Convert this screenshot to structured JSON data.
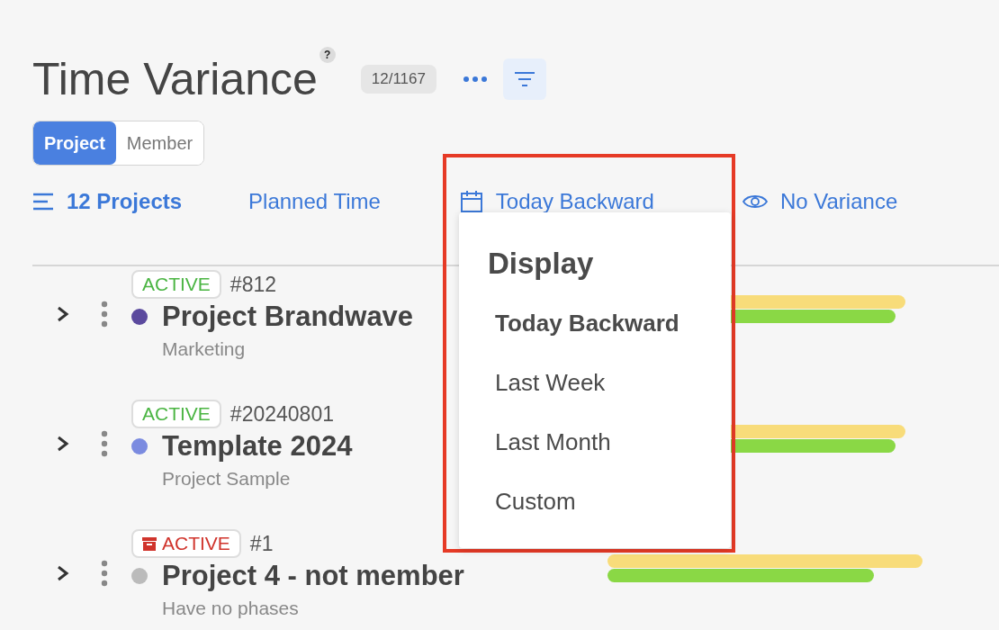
{
  "header": {
    "title": "Time Variance",
    "help": "?",
    "count": "12/1167"
  },
  "view_toggle": [
    {
      "label": "Project",
      "selected": true
    },
    {
      "label": "Member",
      "selected": false
    }
  ],
  "toolbar": [
    {
      "kind": "list",
      "label": "12 Projects"
    },
    {
      "kind": "plain",
      "label": "Planned Time"
    },
    {
      "kind": "calendar",
      "label": "Today Backward"
    },
    {
      "kind": "eye",
      "label": "No Variance"
    }
  ],
  "rows": [
    {
      "status": "ACTIVE",
      "archived": false,
      "number": "#812",
      "name": "Project Brandwave",
      "color": "#5b4a9e",
      "subtitle": "Marketing",
      "bars": [
        {
          "kind": "planned",
          "level": 0.86
        },
        {
          "kind": "actual",
          "level": 0.83
        }
      ]
    },
    {
      "status": "ACTIVE",
      "archived": false,
      "number": "#20240801",
      "name": "Template 2024",
      "color": "#7b8be0",
      "subtitle": "Project Sample",
      "bars": [
        {
          "kind": "planned",
          "level": 0.86
        },
        {
          "kind": "actual",
          "level": 0.83
        }
      ]
    },
    {
      "status": "ACTIVE",
      "archived": true,
      "number": "#1",
      "name": "Project 4 - not member",
      "color": "#bbbbbb",
      "subtitle": "Have no phases",
      "bars": [
        {
          "kind": "planned",
          "level": 0.91
        },
        {
          "kind": "actual",
          "level": 0.77
        }
      ]
    }
  ],
  "dropdown": {
    "title": "Display",
    "options": [
      {
        "label": "Today Backward",
        "selected": true
      },
      {
        "label": "Last Week",
        "selected": false
      },
      {
        "label": "Last Month",
        "selected": false
      },
      {
        "label": "Custom",
        "selected": false
      }
    ]
  }
}
